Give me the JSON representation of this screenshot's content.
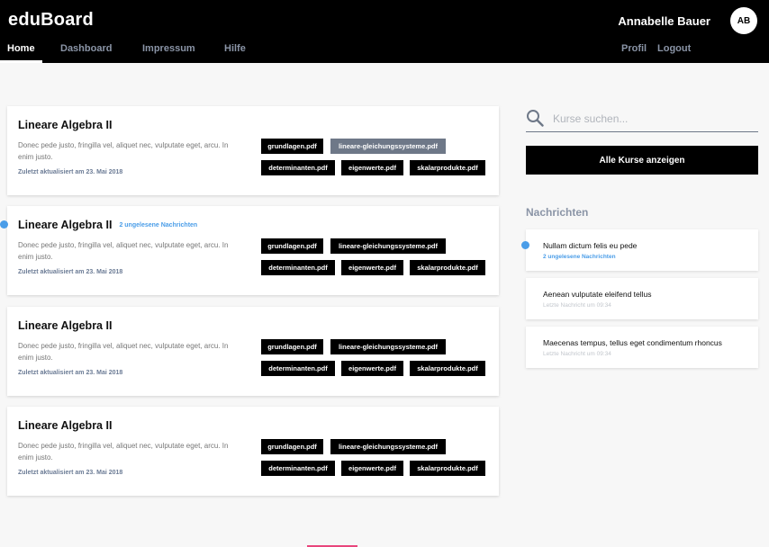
{
  "header": {
    "brand": "eduBoard",
    "user_name": "Annabelle Bauer",
    "avatar_initials": "AB",
    "nav": [
      "Home",
      "Dashboard",
      "Impressum",
      "Hilfe"
    ],
    "active_nav": "Home",
    "profile_label": "Profil",
    "logout_label": "Logout"
  },
  "courses": [
    {
      "title": "Lineare Algebra II",
      "badge": "",
      "description": "Donec pede justo, fringilla vel, aliquet nec, vulputate eget, arcu. In enim justo.",
      "updated": "Zuletzt aktualisiert am 23. Mai 2018",
      "files": [
        "grundlagen.pdf",
        "lineare-gleichungssysteme.pdf",
        "determinanten.pdf",
        "eigenwerte.pdf",
        "skalarprodukte.pdf"
      ],
      "selected_file": "lineare-gleichungssysteme.pdf"
    },
    {
      "title": "Lineare Algebra II",
      "badge": "2 ungelesene Nachrichten",
      "description": "Donec pede justo, fringilla vel, aliquet nec, vulputate eget, arcu. In enim justo.",
      "updated": "Zuletzt aktualisiert am 23. Mai 2018",
      "files": [
        "grundlagen.pdf",
        "lineare-gleichungssysteme.pdf",
        "determinanten.pdf",
        "eigenwerte.pdf",
        "skalarprodukte.pdf"
      ],
      "selected_file": ""
    },
    {
      "title": "Lineare Algebra II",
      "badge": "",
      "description": "Donec pede justo, fringilla vel, aliquet nec, vulputate eget, arcu. In enim justo.",
      "updated": "Zuletzt aktualisiert am 23. Mai 2018",
      "files": [
        "grundlagen.pdf",
        "lineare-gleichungssysteme.pdf",
        "determinanten.pdf",
        "eigenwerte.pdf",
        "skalarprodukte.pdf"
      ],
      "selected_file": ""
    },
    {
      "title": "Lineare Algebra II",
      "badge": "",
      "description": "Donec pede justo, fringilla vel, aliquet nec, vulputate eget, arcu. In enim justo.",
      "updated": "Zuletzt aktualisiert am 23. Mai 2018",
      "files": [
        "grundlagen.pdf",
        "lineare-gleichungssysteme.pdf",
        "determinanten.pdf",
        "eigenwerte.pdf",
        "skalarprodukte.pdf"
      ],
      "selected_file": ""
    }
  ],
  "search": {
    "placeholder": "Kurse suchen...",
    "value": ""
  },
  "all_courses_button": "Alle Kurse anzeigen",
  "messages": {
    "heading": "Nachrichten",
    "items": [
      {
        "title": "Nullam dictum felis eu pede",
        "subtitle": "2 ungelesene Nachrichten",
        "unread": true
      },
      {
        "title": "Aenean vulputate eleifend tellus",
        "subtitle": "Letzte Nachricht um 09:34",
        "unread": false
      },
      {
        "title": "Maecenas tempus, tellus eget condimentum rhoncus",
        "subtitle": "Letzte Nachricht um 09:34",
        "unread": false
      }
    ]
  },
  "colors": {
    "header_bg": "#000000",
    "accent_blue": "#4a9de8",
    "selected_tag": "#6e7888",
    "bottom_accent": "#e8467c"
  }
}
